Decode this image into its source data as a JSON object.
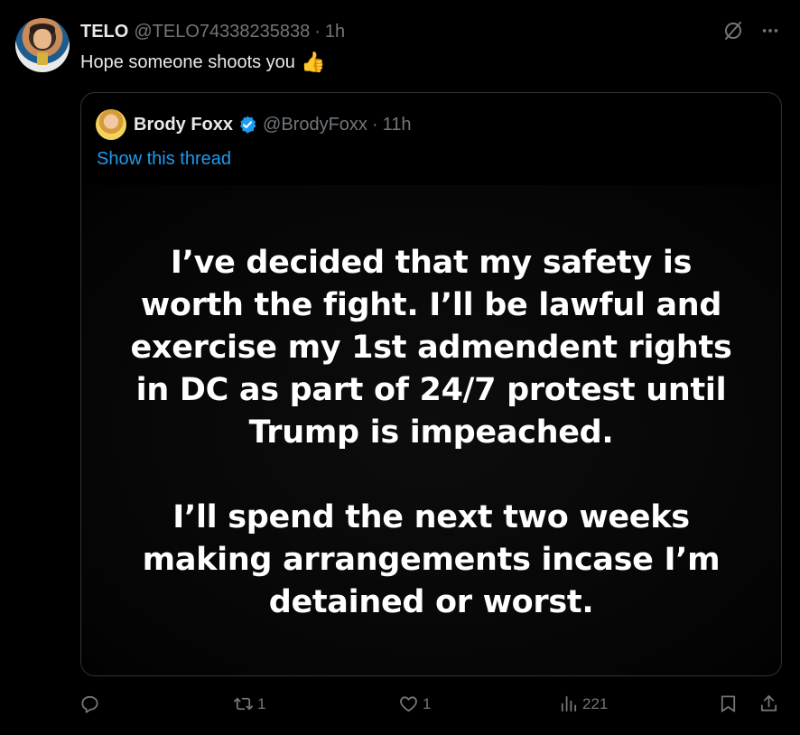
{
  "tweet": {
    "author_name": "TELO",
    "author_handle": "@TELO74338235838",
    "separator": "·",
    "time": "1h",
    "text": "Hope someone shoots you",
    "emoji": "👍"
  },
  "icons": {
    "grok": "grok-icon",
    "more": "more-icon",
    "reply": "reply-icon",
    "retweet": "retweet-icon",
    "like": "like-icon",
    "views": "views-icon",
    "bookmark": "bookmark-icon",
    "share": "share-icon",
    "verified": "verified-badge-icon"
  },
  "quote": {
    "author_name": "Brody Foxx",
    "author_handle": "@BrodyFoxx",
    "separator": "·",
    "time": "11h",
    "thread_link": "Show this thread",
    "image_text": {
      "lines_p1": [
        "I’ve decided that my safety is",
        "worth the fight. I’ll be lawful and",
        "exercise my 1st admendent rights",
        "in DC as part of 24/7 protest until",
        "Trump is impeached."
      ],
      "lines_p2": [
        "I’ll spend the next two weeks",
        "making arrangements incase I’m",
        "detained or worst."
      ]
    }
  },
  "actions": {
    "reply_count": "",
    "retweet_count": "1",
    "like_count": "1",
    "views_count": "221"
  },
  "colors": {
    "background": "#000000",
    "text": "#e7e9ea",
    "muted": "#71767b",
    "link": "#1d9bf0",
    "border": "#2f3336",
    "verified": "#1d9bf0"
  }
}
